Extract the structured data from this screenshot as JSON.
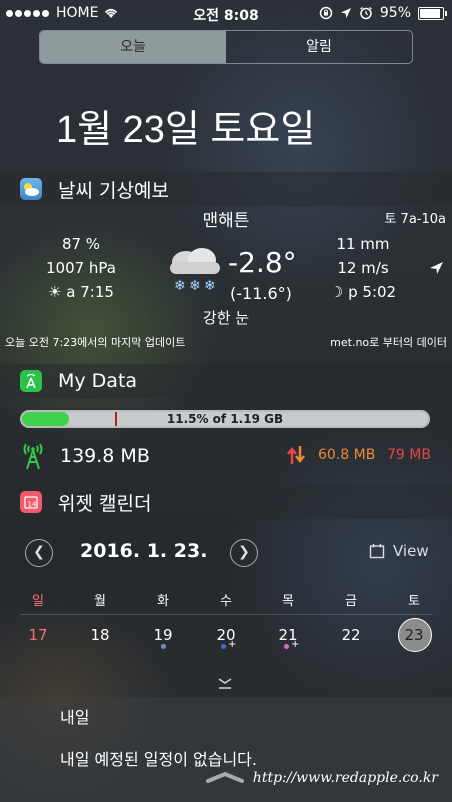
{
  "status_bar": {
    "carrier": "HOME",
    "time": "오전 8:08",
    "battery": "95%"
  },
  "tabs": [
    {
      "label": "오늘",
      "active": true
    },
    {
      "label": "알림",
      "active": false
    }
  ],
  "date_header": "1월 23일 토요일",
  "weather": {
    "section_title": "날씨 기상예보",
    "city": "맨해튼",
    "time_range": "토 7a-10a",
    "humidity": "87 %",
    "pressure": "1007 hPa",
    "sunrise": "a 7:15",
    "temperature": "-2.8°",
    "feels_like": "(-11.6°)",
    "condition": "강한 눈",
    "precipitation": "11 mm",
    "wind": "12 m/s",
    "moonset": "p 5:02",
    "updated": "오늘 오전 7:23에서의 마지막 업데이트",
    "source": "met.no로 부터의 데이터",
    "icon": "snow-cloud-icon"
  },
  "mydata": {
    "section_title": "My Data",
    "usage_text": "11.5% of 1.19 GB",
    "usage_fraction": 0.115,
    "marker_fraction": 0.23,
    "used": "139.8 MB",
    "upload": "60.8 MB",
    "download": "79 MB",
    "bar_color": "#3fd24a",
    "upload_color": "#f0883a",
    "download_color": "#e8454a"
  },
  "calendar": {
    "section_title": "위젯 캘린더",
    "date_label": "2016. 1. 23.",
    "view_label": "View",
    "weekdays": [
      "일",
      "월",
      "화",
      "수",
      "목",
      "금",
      "토"
    ],
    "days": [
      "17",
      "18",
      "19",
      "20",
      "21",
      "22",
      "23"
    ],
    "tomorrow_label": "내일",
    "no_events": "내일 예정된 일정이 없습니다."
  },
  "watermark": "http://www.redapple.co.kr"
}
